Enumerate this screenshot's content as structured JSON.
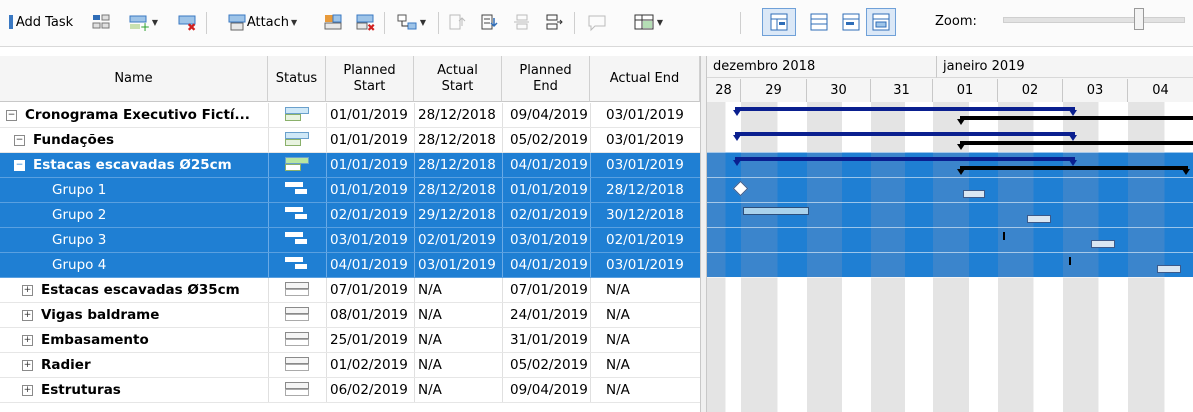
{
  "toolbar": {
    "add_task_label": "Add Task",
    "attach_label": "Attach",
    "zoom_label": "Zoom:"
  },
  "columns": {
    "name": "Name",
    "status": "Status",
    "planned_start": "Planned Start",
    "actual_start": "Actual Start",
    "planned_end": "Planned End",
    "actual_end": "Actual End"
  },
  "rows": [
    {
      "name": "Cronograma Executivo Fictí...",
      "planned_start": "01/01/2019",
      "actual_start": "28/12/2018",
      "planned_end": "09/04/2019",
      "actual_end": "03/01/2019"
    },
    {
      "name": "Fundações",
      "planned_start": "01/01/2019",
      "actual_start": "28/12/2018",
      "planned_end": "05/02/2019",
      "actual_end": "03/01/2019"
    },
    {
      "name": "Estacas escavadas Ø25cm",
      "planned_start": "01/01/2019",
      "actual_start": "28/12/2018",
      "planned_end": "04/01/2019",
      "actual_end": "03/01/2019"
    },
    {
      "name": "Grupo 1",
      "planned_start": "01/01/2019",
      "actual_start": "28/12/2018",
      "planned_end": "01/01/2019",
      "actual_end": "28/12/2018"
    },
    {
      "name": "Grupo 2",
      "planned_start": "02/01/2019",
      "actual_start": "29/12/2018",
      "planned_end": "02/01/2019",
      "actual_end": "30/12/2018"
    },
    {
      "name": "Grupo 3",
      "planned_start": "03/01/2019",
      "actual_start": "02/01/2019",
      "planned_end": "03/01/2019",
      "actual_end": "02/01/2019"
    },
    {
      "name": "Grupo 4",
      "planned_start": "04/01/2019",
      "actual_start": "03/01/2019",
      "planned_end": "04/01/2019",
      "actual_end": "03/01/2019"
    },
    {
      "name": "Estacas escavadas Ø35cm",
      "planned_start": "07/01/2019",
      "actual_start": "N/A",
      "planned_end": "07/01/2019",
      "actual_end": "N/A"
    },
    {
      "name": "Vigas baldrame",
      "planned_start": "08/01/2019",
      "actual_start": "N/A",
      "planned_end": "24/01/2019",
      "actual_end": "N/A"
    },
    {
      "name": "Embasamento",
      "planned_start": "25/01/2019",
      "actual_start": "N/A",
      "planned_end": "31/01/2019",
      "actual_end": "N/A"
    },
    {
      "name": "Radier",
      "planned_start": "01/02/2019",
      "actual_start": "N/A",
      "planned_end": "05/02/2019",
      "actual_end": "N/A"
    },
    {
      "name": "Estruturas",
      "planned_start": "06/02/2019",
      "actual_start": "N/A",
      "planned_end": "09/04/2019",
      "actual_end": "N/A"
    }
  ],
  "gantt": {
    "months": [
      "dezembro 2018",
      "janeiro 2019"
    ],
    "days": [
      "28",
      "29",
      "30",
      "31",
      "01",
      "02",
      "03",
      "04"
    ]
  },
  "colors": {
    "selection": "#1f7fd3",
    "summary_bar": "#0a1f8f",
    "actual_summary": "#000000"
  }
}
